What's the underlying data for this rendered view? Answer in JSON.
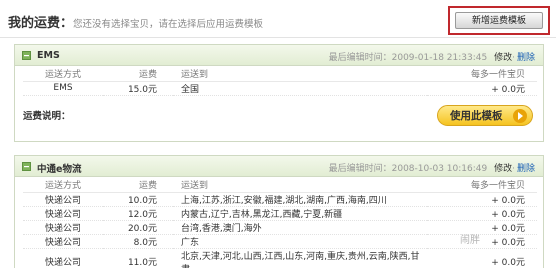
{
  "header": {
    "title_prefix": "我的运费：",
    "hint": "您还没有选择宝贝，请在选择后应用运费模板",
    "add_button": "新增运费模板"
  },
  "columns": [
    "运送方式",
    "运费",
    "运送到",
    "每多一件宝贝"
  ],
  "panels": [
    {
      "name": "EMS",
      "edited": "最后编辑时间：2009-01-18 21:33:45",
      "edit_label": "修改",
      "delete_label": "删除",
      "rows": [
        {
          "method": "EMS",
          "fee": "15.0元",
          "dest": "全国",
          "extra": "+ 0.0元"
        }
      ],
      "note_label": "运费说明：",
      "use_button": "使用此模板"
    },
    {
      "name": "中通e物流",
      "edited": "最后编辑时间：2008-10-03 10:16:49",
      "edit_label": "修改",
      "delete_label": "删除",
      "rows": [
        {
          "method": "快递公司",
          "fee": "10.0元",
          "dest": "上海,江苏,浙江,安徽,福建,湖北,湖南,广西,海南,四川",
          "extra": "+ 0.0元"
        },
        {
          "method": "快递公司",
          "fee": "12.0元",
          "dest": "内蒙古,辽宁,吉林,黑龙江,西藏,宁夏,新疆",
          "extra": "+ 0.0元"
        },
        {
          "method": "快递公司",
          "fee": "20.0元",
          "dest": "台湾,香港,澳门,海外",
          "extra": "+ 0.0元"
        },
        {
          "method": "快递公司",
          "fee": "8.0元",
          "dest": "广东",
          "extra": "+ 0.0元"
        },
        {
          "method": "快递公司",
          "fee": "11.0元",
          "dest": "北京,天津,河北,山西,江西,山东,河南,重庆,贵州,云南,陕西,甘肃,",
          "extra": "+ 0.0元"
        }
      ]
    }
  ],
  "watermark": "闹胖"
}
